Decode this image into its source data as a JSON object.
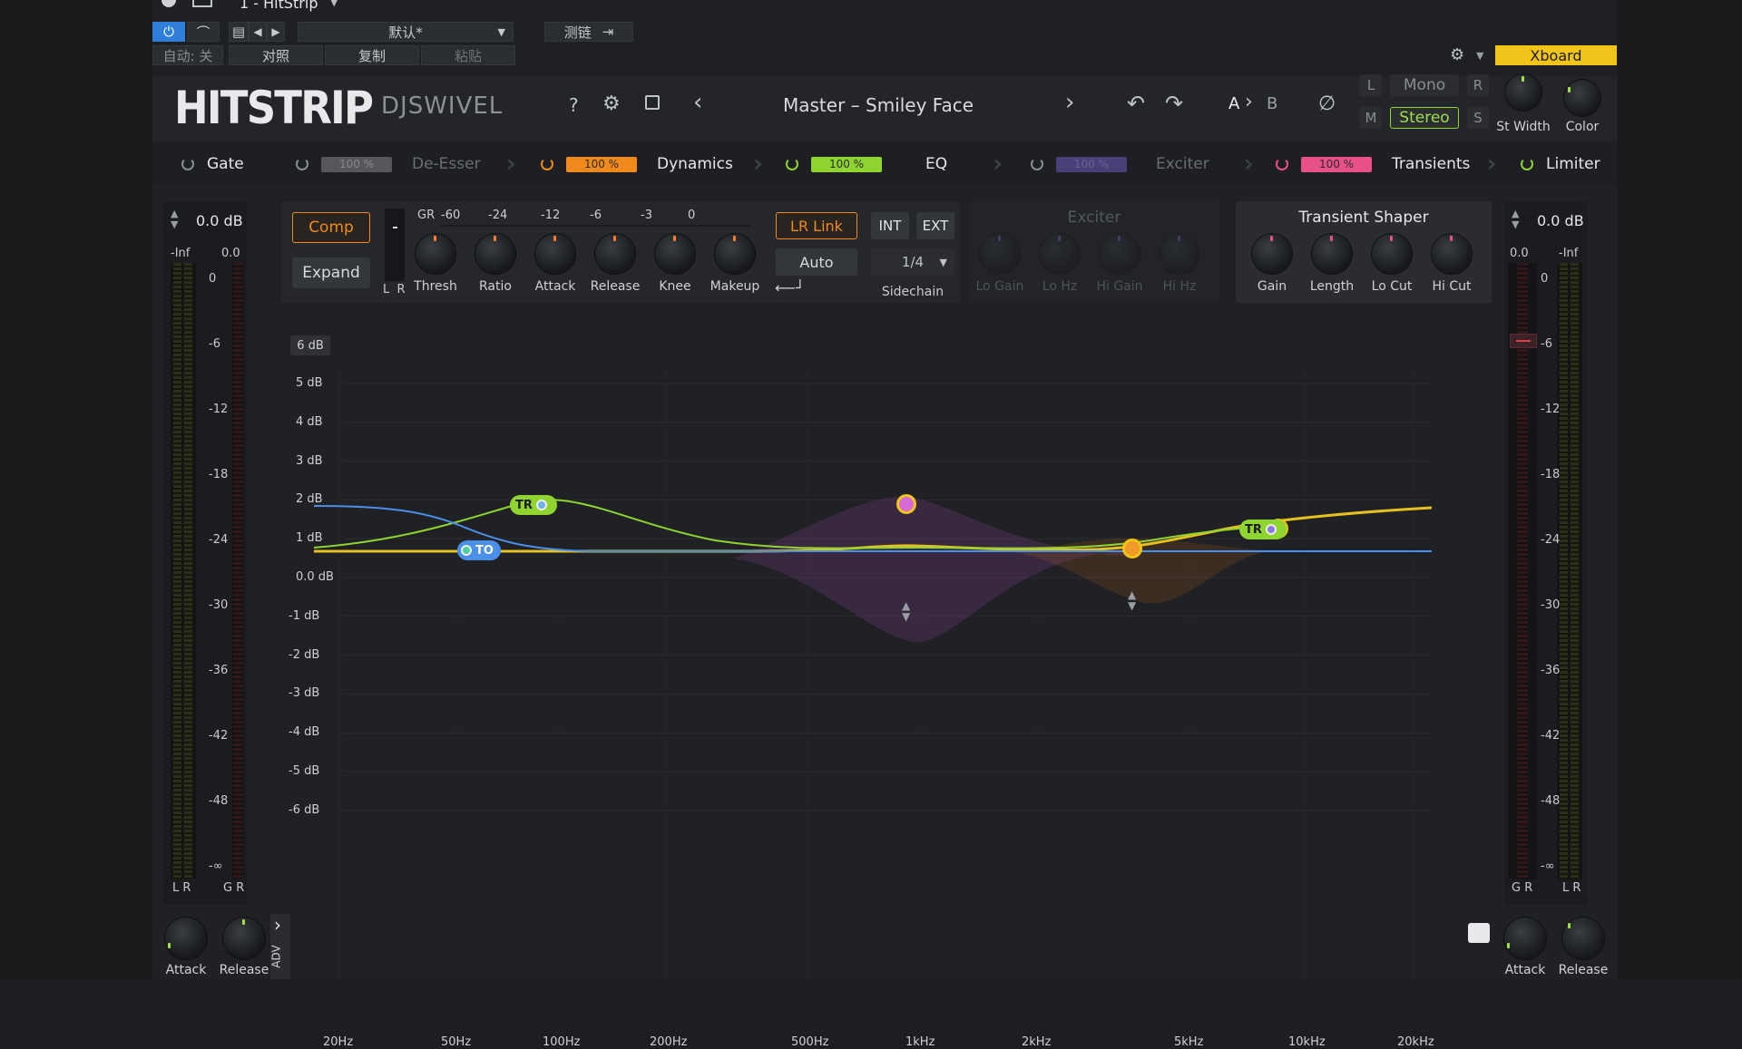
{
  "host": {
    "track_title": "1 - HitStrip",
    "preset": "默认*",
    "sidechain": "测链",
    "auto_state": "自动: 关",
    "compare": "对照",
    "copy": "复制",
    "paste": "粘贴",
    "xboard": "Xboard"
  },
  "header": {
    "logo": "HITSTRIP",
    "brand": "DJSWIVEL",
    "help": "?",
    "preset_name": "Master – Smiley Face",
    "ab_a": "A",
    "ab_sep": "›",
    "ab_b": "B",
    "mono": "Mono",
    "stereo": "Stereo",
    "l": "L",
    "r": "R",
    "m": "M",
    "s": "S",
    "st_width": "St Width",
    "color": "Color"
  },
  "modules": [
    {
      "name": "Gate",
      "pct": "",
      "active": true
    },
    {
      "name": "De-Esser",
      "pct": "100 %",
      "active": false,
      "color": "#6b6d70"
    },
    {
      "name": "Dynamics",
      "pct": "100 %",
      "active": true,
      "color": "#f08a1c"
    },
    {
      "name": "EQ",
      "pct": "100 %",
      "active": true,
      "color": "#8fd431"
    },
    {
      "name": "Exciter",
      "pct": "100 %",
      "active": false,
      "color": "#4a3f78"
    },
    {
      "name": "Transients",
      "pct": "100 %",
      "active": true,
      "color": "#e8508a"
    },
    {
      "name": "Limiter",
      "pct": "",
      "active": true
    }
  ],
  "dynamics": {
    "comp": "Comp",
    "expand": "Expand",
    "gr_label": "GR",
    "gr_scale": [
      "-60",
      "-24",
      "-12",
      "-6",
      "-3",
      "0"
    ],
    "lr": "L  R",
    "knobs": [
      "Thresh",
      "Ratio",
      "Attack",
      "Release",
      "Knee",
      "Makeup"
    ],
    "lr_link": "LR Link",
    "auto": "Auto",
    "int": "INT",
    "ext": "EXT",
    "sidechain_value": "1/4",
    "sidechain_label": "Sidechain"
  },
  "exciter": {
    "title": "Exciter",
    "knobs": [
      "Lo Gain",
      "Lo Hz",
      "Hi Gain",
      "Hi Hz"
    ]
  },
  "transient": {
    "title": "Transient Shaper",
    "knobs": [
      "Gain",
      "Length",
      "Lo Cut",
      "Hi Cut"
    ]
  },
  "left_meter": {
    "db": "0.0 dB",
    "top_left": "-Inf",
    "top_right": "0.0",
    "scale": [
      "0",
      "-6",
      "-12",
      "-18",
      "-24",
      "-30",
      "-36",
      "-42",
      "-48",
      "-∞"
    ],
    "bottom_left": "L R",
    "bottom_right": "G R",
    "attack": "Attack",
    "release": "Release",
    "adv": "ADV"
  },
  "right_meter": {
    "db": "0.0 dB",
    "top_left": "0.0",
    "top_right": "-Inf",
    "scale": [
      "0",
      "-6",
      "-12",
      "-18",
      "-24",
      "-30",
      "-36",
      "-42",
      "-48",
      "-∞"
    ],
    "bottom_left": "G R",
    "bottom_right": "L R",
    "attack": "Attack",
    "release": "Release"
  },
  "graph": {
    "range_button": "6 dB",
    "db_labels": [
      "5 dB",
      "4 dB",
      "3 dB",
      "2 dB",
      "1 dB",
      "0.0 dB",
      "-1 dB",
      "-2 dB",
      "-3 dB",
      "-4 dB",
      "-5 dB",
      "-6 dB"
    ],
    "freq_labels": [
      "20Hz",
      "50Hz",
      "100Hz",
      "200Hz",
      "500Hz",
      "1kHz",
      "2kHz",
      "5kHz",
      "10kHz",
      "20kHz"
    ],
    "nodes": [
      {
        "label": "TO",
        "color": "#4a8fe8"
      },
      {
        "label": "TR",
        "color": "#8fd431"
      },
      {
        "label": "TR",
        "color": "#8fd431"
      }
    ]
  }
}
